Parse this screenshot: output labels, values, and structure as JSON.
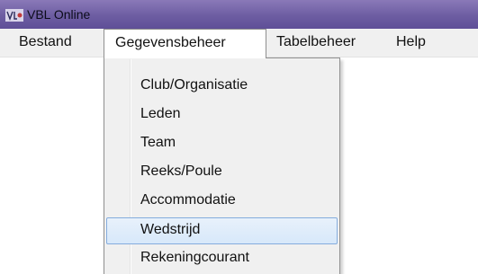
{
  "window": {
    "title": "VBL Online",
    "icon": "app-logo-icon"
  },
  "menubar": {
    "items": [
      {
        "label": "Bestand"
      },
      {
        "label": "Gegevensbeheer",
        "open": true
      },
      {
        "label": "Tabelbeheer"
      },
      {
        "label": "Help"
      }
    ]
  },
  "dropdown": {
    "items": [
      {
        "label": "Club/Organisatie"
      },
      {
        "label": "Leden"
      },
      {
        "label": "Team"
      },
      {
        "label": "Reeks/Poule"
      },
      {
        "label": "Accommodatie"
      },
      {
        "label": "Wedstrijd",
        "highlighted": true
      },
      {
        "label": "Rekeningcourant"
      }
    ]
  },
  "colors": {
    "titlebar": "#6d5da2",
    "menubar_bg": "#f0f0f0",
    "highlight_bg": "#d7e8fa",
    "highlight_border": "#84acdd"
  }
}
